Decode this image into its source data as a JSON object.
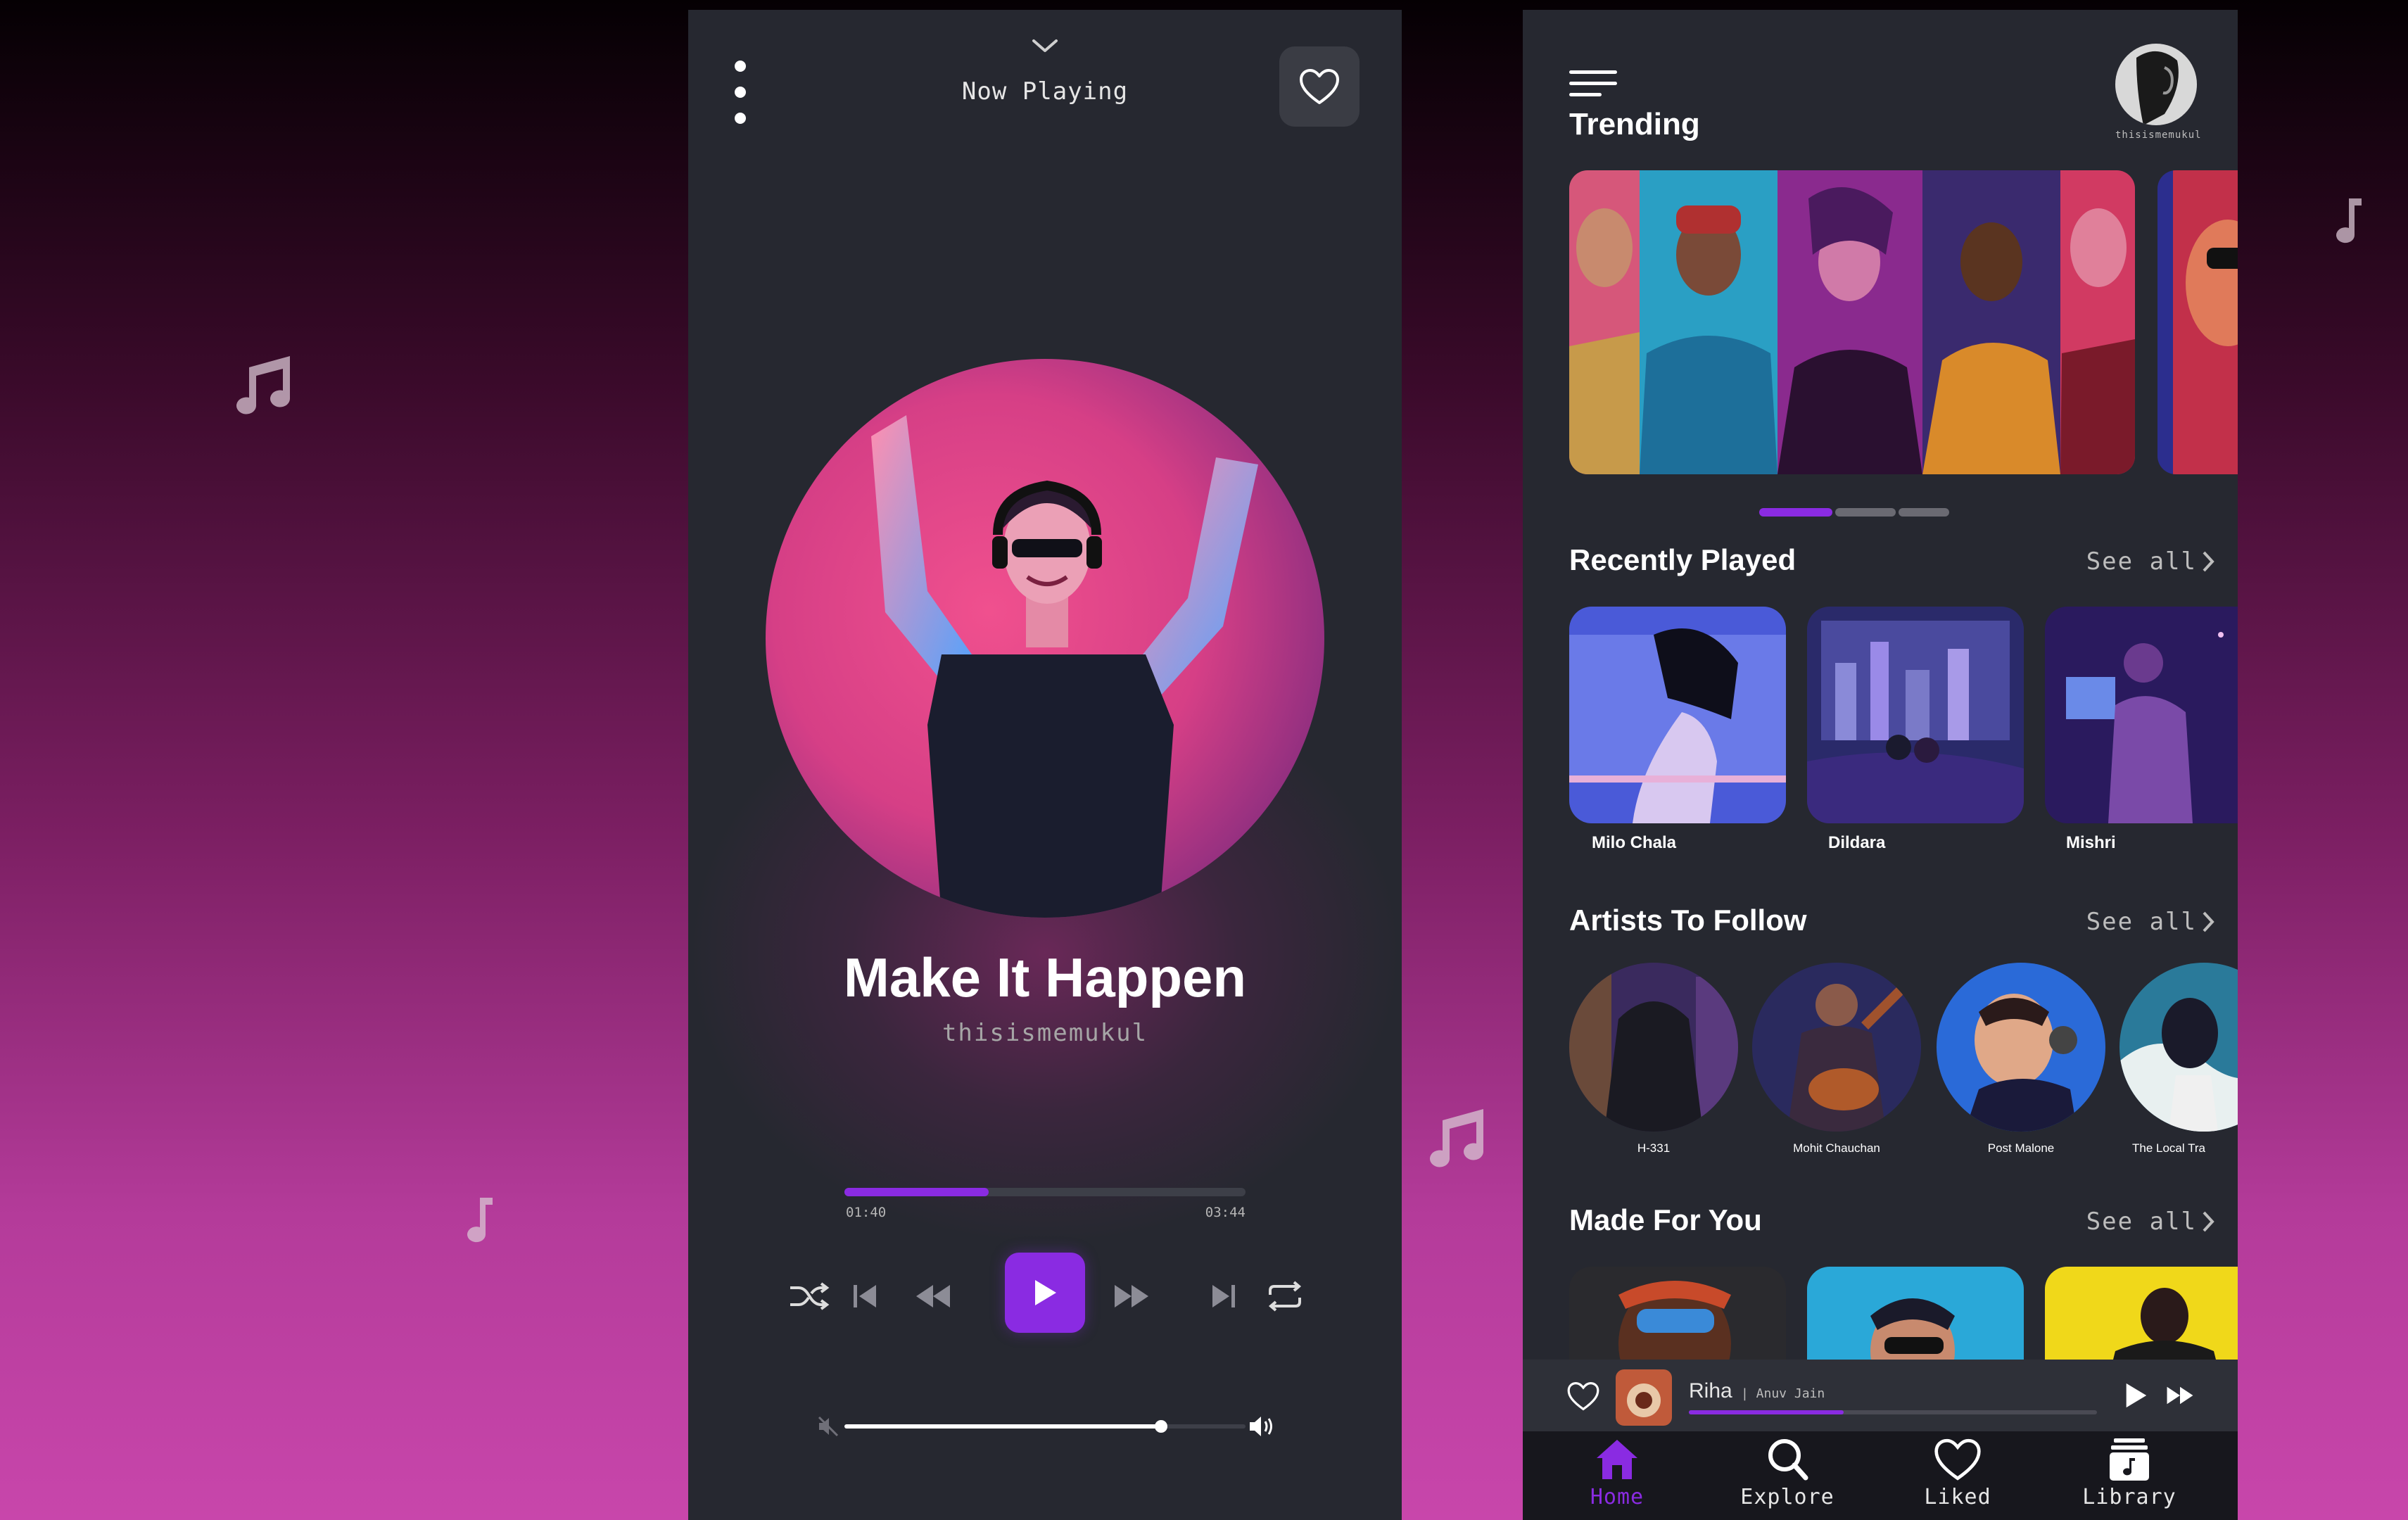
{
  "colors": {
    "accent": "#8a2be2",
    "panel": "#262830",
    "nav_bg": "#17171d",
    "muted_text": "#a6a6a6"
  },
  "decor_icons": [
    "music-notes-icon",
    "music-note-icon"
  ],
  "player": {
    "header": {
      "collapse_icon": "chevron-down-icon",
      "menu_icon": "kebab-menu-icon",
      "title": "Now Playing",
      "like_icon": "heart-outline-icon"
    },
    "track": {
      "title": "Make It Happen",
      "artist": "thisismemukul"
    },
    "progress": {
      "current": "01:40",
      "total": "03:44",
      "fraction": 0.36
    },
    "controls": [
      "shuffle-icon",
      "skip-previous-icon",
      "rewind-icon",
      "play-icon",
      "fast-forward-icon",
      "skip-next-icon",
      "repeat-icon"
    ],
    "volume": {
      "level": 0.79,
      "mute_icon": "volume-mute-icon",
      "max_icon": "volume-up-icon"
    }
  },
  "home": {
    "menu_icon": "hamburger-menu-icon",
    "title": "Trending",
    "profile": {
      "username": "thisismemukul"
    },
    "carousel": {
      "active_index": 0,
      "count": 3
    },
    "recently_played": {
      "title": "Recently Played",
      "see_all": "See all",
      "items": [
        {
          "label": "Milo Chala"
        },
        {
          "label": "Dildara"
        },
        {
          "label": "Mishri"
        }
      ]
    },
    "artists": {
      "title": "Artists To Follow",
      "see_all": "See all",
      "items": [
        {
          "label": "H-331"
        },
        {
          "label": "Mohit Chauchan"
        },
        {
          "label": "Post Malone"
        },
        {
          "label": "The Local Tra"
        }
      ]
    },
    "made_for_you": {
      "title": "Made For You",
      "see_all": "See all"
    },
    "mini_player": {
      "title": "Riha",
      "artist": "| Anuv Jain",
      "progress": 0.38
    },
    "nav": {
      "items": [
        {
          "label": "Home",
          "icon": "home-icon",
          "active": true
        },
        {
          "label": "Explore",
          "icon": "search-icon",
          "active": false
        },
        {
          "label": "Liked",
          "icon": "heart-icon",
          "active": false
        },
        {
          "label": "Library",
          "icon": "library-icon",
          "active": false
        }
      ]
    }
  }
}
